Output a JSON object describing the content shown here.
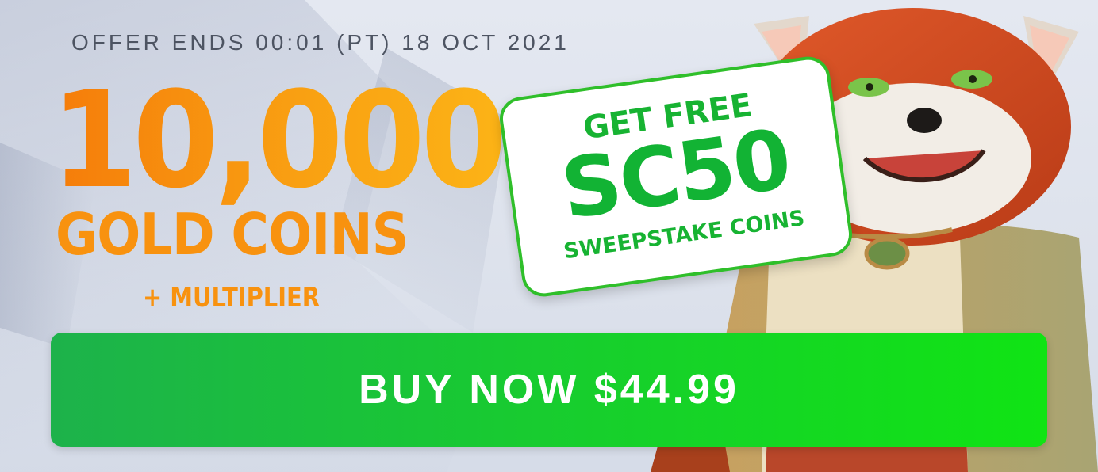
{
  "offer": {
    "ends_text": "OFFER ENDS 00:01 (PT) 18 OCT 2021"
  },
  "headline": {
    "amount": "10,000",
    "coins_label": "GOLD COINS",
    "multiplier": "+ MULTIPLIER"
  },
  "promo_card": {
    "top": "GET FREE",
    "main": "SC50",
    "sub": "SWEEPSTAKE COINS"
  },
  "cta": {
    "label": "BUY NOW $44.99"
  },
  "colors": {
    "gold": "#f8920f",
    "green": "#17cf2c",
    "text_dark": "#4d5462"
  }
}
